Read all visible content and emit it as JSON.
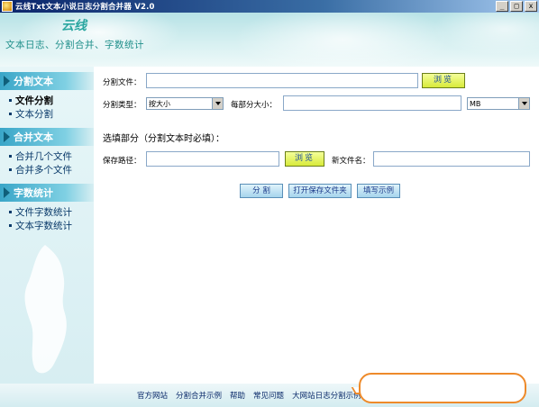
{
  "window": {
    "title": "云线Txt文本小说日志分割合并器 V2.0",
    "minimize_glyph": "_",
    "maximize_glyph": "□",
    "close_glyph": "x"
  },
  "banner": {
    "brand": "云线",
    "slogan": "文本日志、分割合并、字数统计"
  },
  "sidebar": {
    "sections": [
      {
        "title": "分割文本",
        "items": [
          {
            "label": "文件分割",
            "active": true
          },
          {
            "label": "文本分割"
          }
        ]
      },
      {
        "title": "合并文本",
        "items": [
          {
            "label": "合并几个文件"
          },
          {
            "label": "合并多个文件"
          }
        ]
      },
      {
        "title": "字数统计",
        "items": [
          {
            "label": "文件字数统计"
          },
          {
            "label": "文本字数统计"
          }
        ]
      }
    ]
  },
  "main": {
    "split_file_label": "分割文件：",
    "split_file_value": "",
    "browse_label": "浏览",
    "split_type_label": "分割类型：",
    "split_type_value": "按大小",
    "part_size_label": "每部分大小：",
    "part_size_value": "",
    "unit_value": "MB",
    "optional_title": "选填部分（分割文本时必填）：",
    "save_path_label": "保存路径：",
    "save_path_value": "",
    "browse2_label": "浏览",
    "new_filename_label": "新文件名：",
    "new_filename_value": "",
    "split_button": "分 割",
    "open_folder_button": "打开保存文件夹",
    "example_button": "填写示例"
  },
  "footer": {
    "links": [
      "官方网站",
      "分割合并示例",
      "帮助",
      "常见问题",
      "大网站日志分割示例"
    ]
  },
  "colors": {
    "accent": "#3aa6c8",
    "browse_button": "#d8ea3a",
    "balloon_border": "#ee8a2a"
  }
}
